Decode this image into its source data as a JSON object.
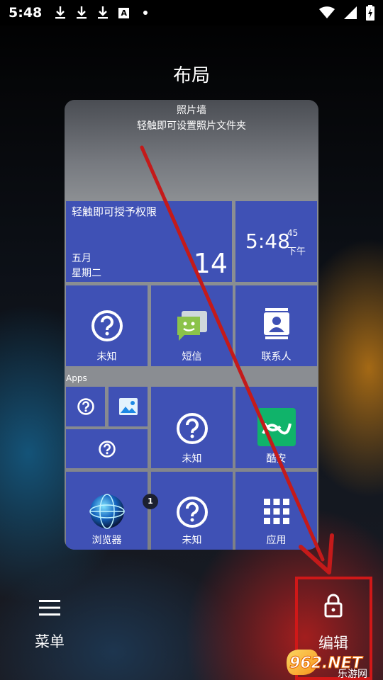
{
  "status_bar": {
    "time": "5:48",
    "icons": [
      "download-icon",
      "download-icon",
      "download-icon",
      "font-a-icon",
      "dot-icon"
    ],
    "right_icons": [
      "wifi-icon",
      "signal-icon",
      "battery-charging-icon"
    ],
    "font_badge_letter": "A"
  },
  "page_title": "布局",
  "preview": {
    "photo_wall": {
      "title": "照片墙",
      "subtitle": "轻触即可设置照片文件夹"
    },
    "calendar_tile": {
      "prompt": "轻触即可授予权限",
      "month": "五月",
      "weekday": "星期二",
      "day": "14"
    },
    "clock_tile": {
      "time": "5:48",
      "seconds": "45",
      "ampm": "下午"
    },
    "row1": [
      {
        "label": "未知",
        "icon": "question-icon"
      },
      {
        "label": "短信",
        "icon": "sms-icon"
      },
      {
        "label": "联系人",
        "icon": "contacts-icon"
      }
    ],
    "apps_section_label": "Apps",
    "row2": [
      {
        "label": "未知",
        "icon": "question-icon"
      },
      {
        "label": "酷安",
        "icon": "coolapk-icon"
      }
    ],
    "row3": [
      {
        "label": "浏览器",
        "icon": "globe-icon"
      },
      {
        "label": "未知",
        "icon": "question-icon"
      },
      {
        "label": "应用",
        "icon": "grid-icon"
      }
    ],
    "notification_badge": "1"
  },
  "bottom": {
    "menu_label": "菜单",
    "edit_label": "编辑"
  },
  "watermark": {
    "brand": "962.NET",
    "sub": "乐游网"
  },
  "colors": {
    "tile_blue": "#3f51b5",
    "highlight_red": "#d01818",
    "coolapk_green": "#10b36a",
    "sms_green": "#8bc34a"
  }
}
